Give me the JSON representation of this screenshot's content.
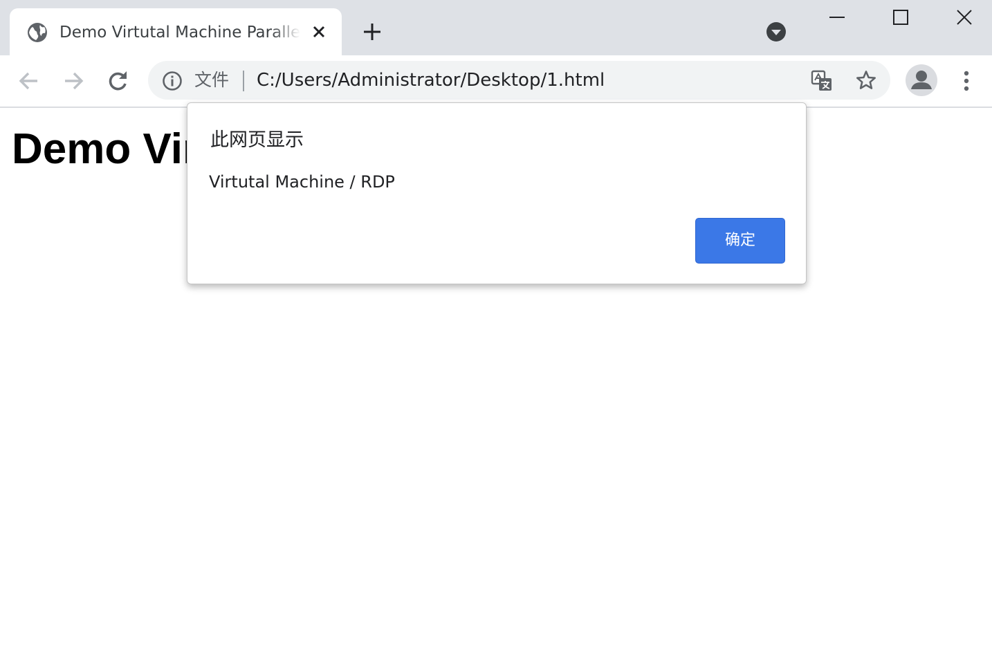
{
  "browser": {
    "tab": {
      "title": "Demo Virtutal Machine Parallel Test!"
    },
    "window_controls": [
      "minimize",
      "maximize",
      "close"
    ],
    "omnibox": {
      "scheme_label": "文件",
      "url": "C:/Users/Administrator/Desktop/1.html"
    },
    "icons": {
      "favicon": "globe-icon",
      "tab_close": "close-icon",
      "new_tab": "plus-icon",
      "tab_search": "tab-search-icon",
      "back": "arrow-left-icon",
      "forward": "arrow-right-icon",
      "reload": "reload-icon",
      "site_info": "info-icon",
      "translate": "translate-icon",
      "bookmark": "star-icon",
      "profile": "person-icon",
      "menu": "more-vert-icon"
    }
  },
  "page": {
    "heading": "Demo Virtutal Machine Parallel Test!"
  },
  "dialog": {
    "title": "此网页显示",
    "message": "Virtutal Machine / RDP",
    "ok_label": "确定",
    "accent_color": "#3b78e7"
  }
}
